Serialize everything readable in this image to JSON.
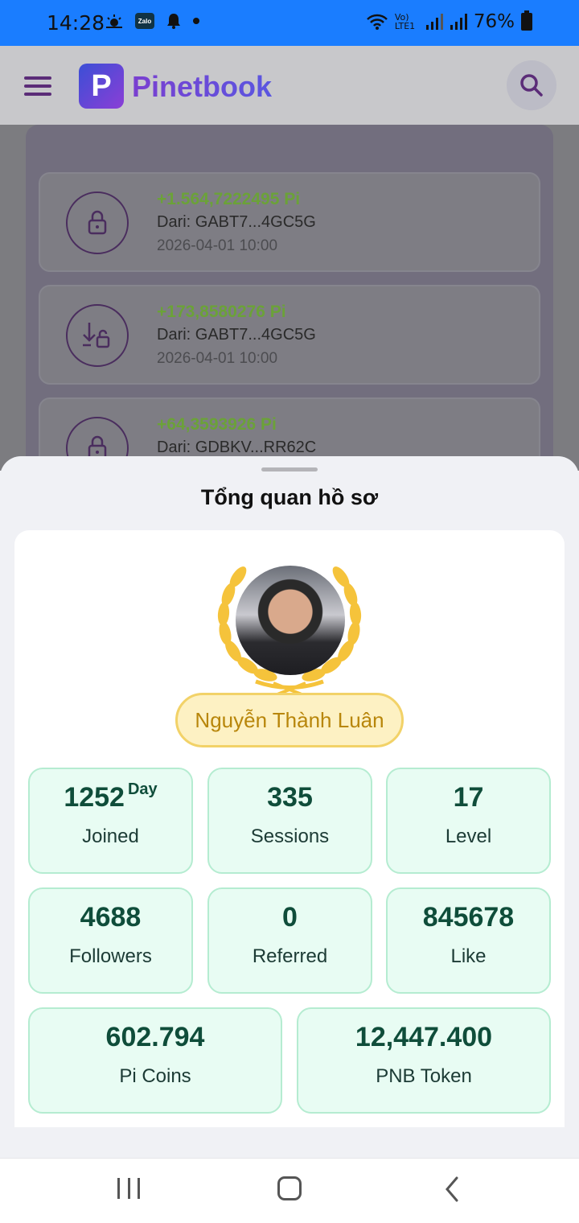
{
  "status_bar": {
    "time": "14:28",
    "icons_left": [
      "weather-icon",
      "zalo-icon",
      "bell-icon",
      "dot-icon"
    ],
    "zalo_label": "Zalo",
    "network": "Vo) LTE1",
    "battery": "76%"
  },
  "header": {
    "brand": "Pinetbook",
    "logo_letter": "P"
  },
  "transactions": [
    {
      "amount": "+1.564,7222495 Pi",
      "from": "Dari: GABT7...4GC5G",
      "date": "2026-04-01 10:00",
      "icon": "lock-icon"
    },
    {
      "amount": "+173,8580276 Pi",
      "from": "Dari: GABT7...4GC5G",
      "date": "2026-04-01 10:00",
      "icon": "download-unlock-icon"
    },
    {
      "amount": "+64,3593926 Pi",
      "from": "Dari: GDBKV...RR62C",
      "date": "",
      "icon": "lock-icon"
    }
  ],
  "sheet": {
    "title": "Tổng quan hồ sơ",
    "name": "Nguyễn Thành Luân",
    "stats": [
      {
        "value": "1252",
        "unit": "Day",
        "label": "Joined"
      },
      {
        "value": "335",
        "label": "Sessions"
      },
      {
        "value": "17",
        "label": "Level"
      },
      {
        "value": "4688",
        "label": "Followers"
      },
      {
        "value": "0",
        "label": "Referred"
      },
      {
        "value": "845678",
        "label": "Like"
      },
      {
        "value": "602.794",
        "label": "Pi Coins"
      },
      {
        "value": "12,447.400",
        "label": "PNB Token"
      }
    ]
  },
  "colors": {
    "status_bar": "#1a7dff",
    "brand": "#7a3fd0",
    "positive_amount": "#6ba238",
    "stat_bg": "#e8fcf3",
    "stat_text": "#0f4d3a",
    "name_pill": "#fdf1c3",
    "wreath": "#f5c33b"
  }
}
